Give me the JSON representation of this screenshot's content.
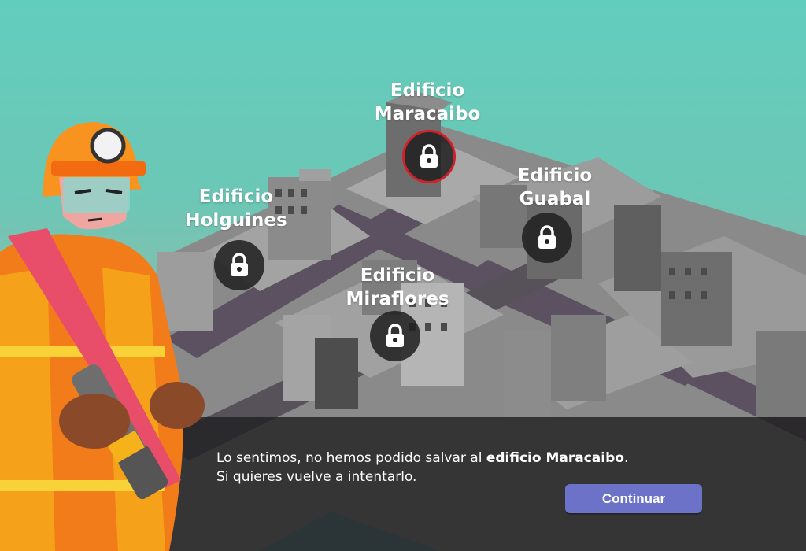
{
  "buildings": [
    {
      "name_line1": "Edificio",
      "name_line2": "Maracaibo",
      "status": "failed",
      "icon": "lock-icon"
    },
    {
      "name_line1": "Edificio",
      "name_line2": "Guabal",
      "status": "locked",
      "icon": "lock-icon"
    },
    {
      "name_line1": "Edificio",
      "name_line2": "Holguines",
      "status": "locked",
      "icon": "lock-icon"
    },
    {
      "name_line1": "Edificio",
      "name_line2": "Miraflores",
      "status": "locked",
      "icon": "lock-icon"
    }
  ],
  "dialog": {
    "message_part1": "Lo sentimos, no hemos podido salvar al ",
    "message_bold": "edificio Maracaibo",
    "message_part2": ".",
    "message_line2": "Si quieres vuelve a intentarlo.",
    "button_label": "Continuar"
  },
  "colors": {
    "accent_button": "#6c72c7",
    "failed_ring": "#d0202a",
    "background": "#63cdbd"
  }
}
